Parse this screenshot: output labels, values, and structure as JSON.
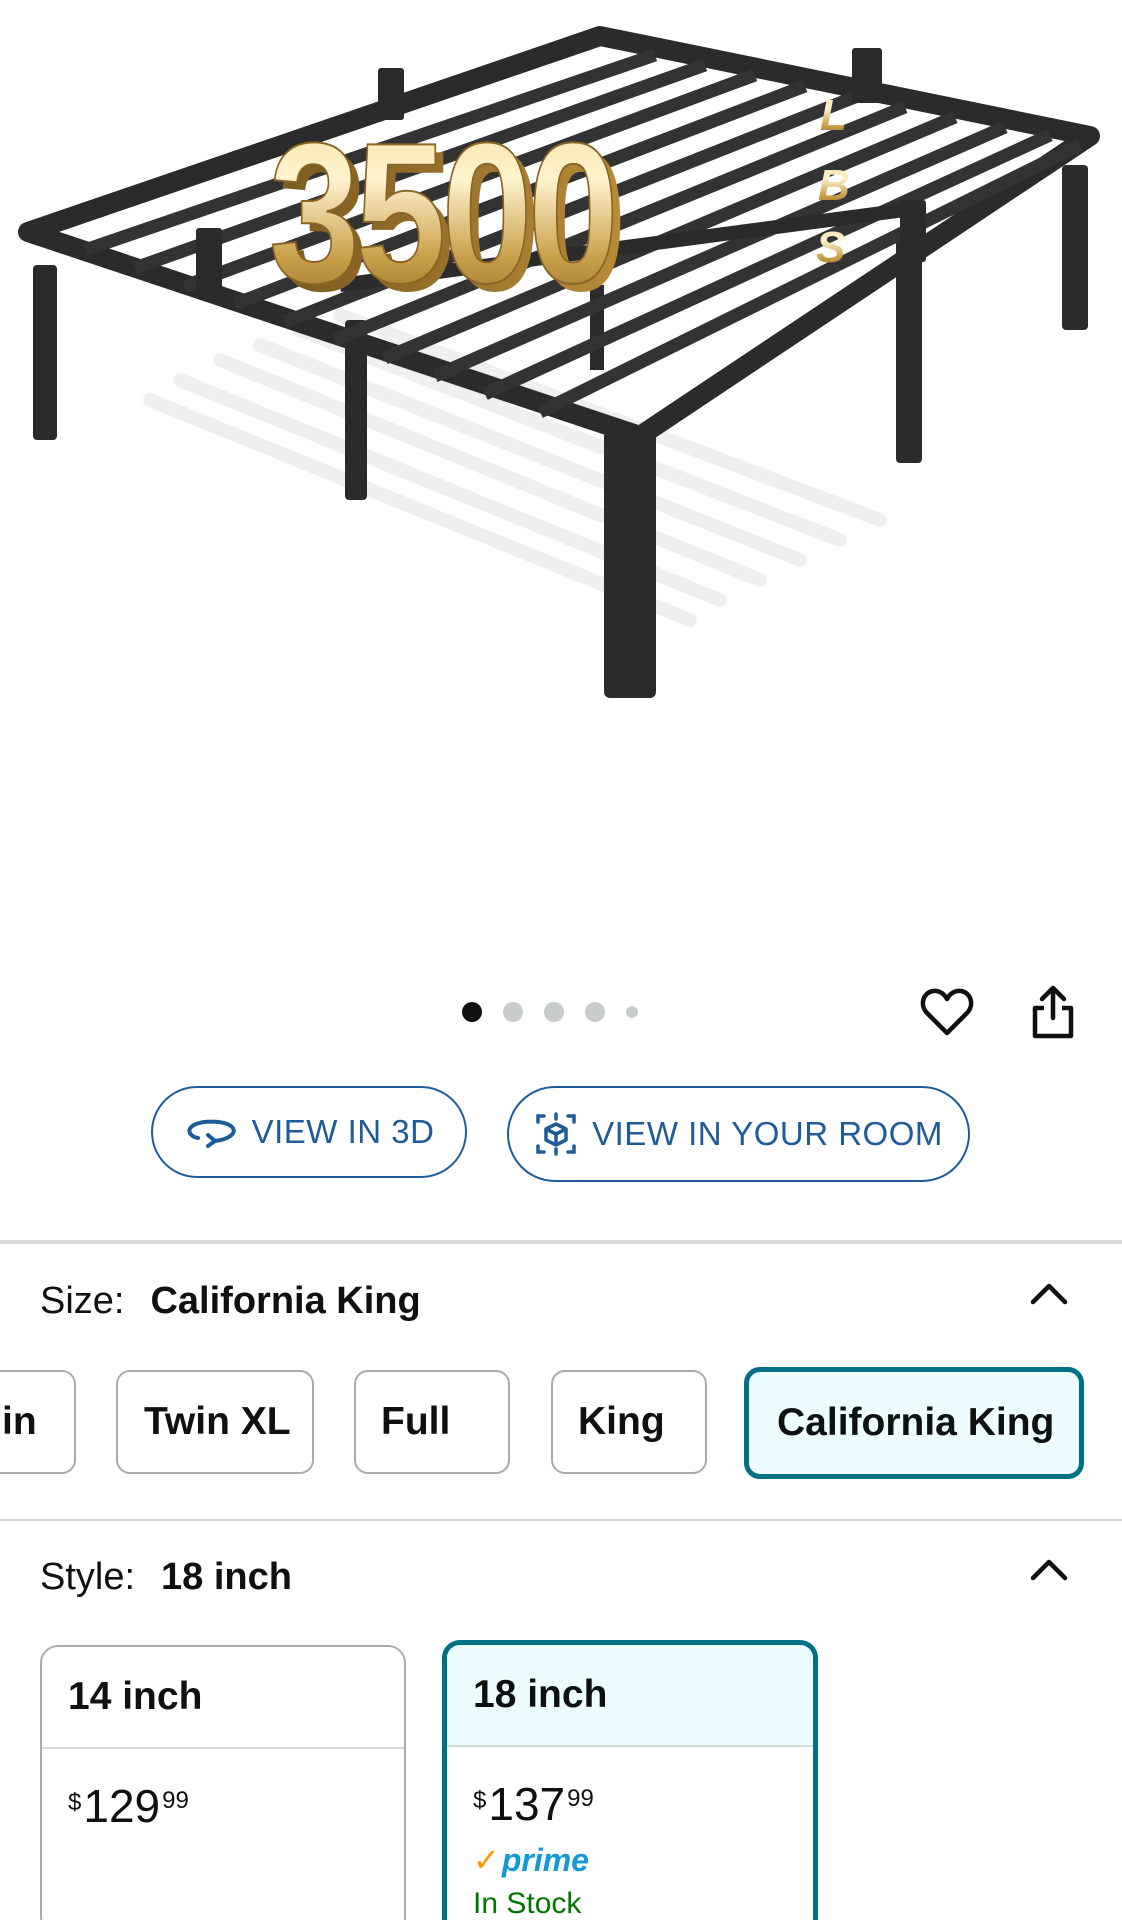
{
  "product_image": {
    "overlay_number": "3500",
    "overlay_unit_letters": [
      "L",
      "B",
      "S"
    ],
    "carousel_count": 5,
    "carousel_active_index": 0
  },
  "actions": {
    "favorite_icon": "heart-outline-icon",
    "share_icon": "share-icon"
  },
  "view_buttons": {
    "view_3d": "VIEW IN 3D",
    "view_room": "VIEW IN YOUR ROOM"
  },
  "size": {
    "label": "Size:",
    "selected": "California King",
    "options": [
      "in",
      "Twin XL",
      "Full",
      "King",
      "California King"
    ],
    "selected_index": 4
  },
  "style": {
    "label": "Style:",
    "selected": "18 inch",
    "cards": [
      {
        "name": "14 inch",
        "price_symbol": "$",
        "price_whole": "129",
        "price_fraction": "99"
      },
      {
        "name": "18 inch",
        "price_symbol": "$",
        "price_whole": "137",
        "price_fraction": "99",
        "prime": "prime",
        "availability": "In Stock"
      }
    ]
  },
  "colors": {
    "link_blue": "#1d5c99",
    "selected_teal": "#007185",
    "selected_bg": "#edfdff",
    "prime_blue": "#1399d6",
    "prime_check": "#ff9900",
    "in_stock": "#007600",
    "gold": "#c9a04a"
  }
}
